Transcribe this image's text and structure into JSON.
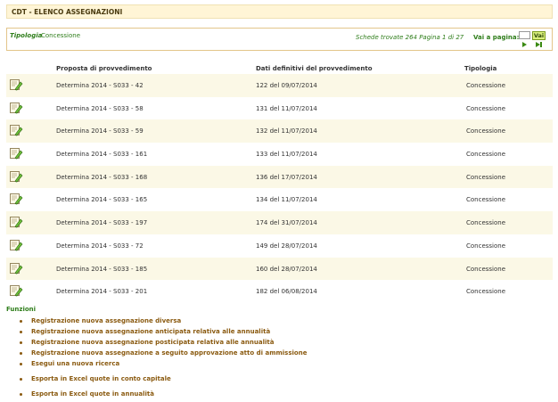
{
  "header": {
    "title": "CDT - ELENCO ASSEGNAZIONI"
  },
  "filter": {
    "tipologia_label": "Tipologia",
    "tipologia_value": "Concessione",
    "schede_text": "Schede trovate 264 Pagina 1 di 27",
    "vai_label": "Vai a pagina:",
    "vai_button": "Vai",
    "page_input_value": ""
  },
  "table": {
    "columns": [
      "Proposta di provvedimento",
      "Dati definitivi del provvedimento",
      "Tipologia"
    ],
    "rows": [
      {
        "proposta": "Determina 2014 - S033 - 42",
        "dati": "122 del 09/07/2014",
        "tipologia": "Concessione"
      },
      {
        "proposta": "Determina 2014 - S033 - 58",
        "dati": "131 del 11/07/2014",
        "tipologia": "Concessione"
      },
      {
        "proposta": "Determina 2014 - S033 - 59",
        "dati": "132 del 11/07/2014",
        "tipologia": "Concessione"
      },
      {
        "proposta": "Determina 2014 - S033 - 161",
        "dati": "133 del 11/07/2014",
        "tipologia": "Concessione"
      },
      {
        "proposta": "Determina 2014 - S033 - 168",
        "dati": "136 del 17/07/2014",
        "tipologia": "Concessione"
      },
      {
        "proposta": "Determina 2014 - S033 - 165",
        "dati": "134 del 11/07/2014",
        "tipologia": "Concessione"
      },
      {
        "proposta": "Determina 2014 - S033 - 197",
        "dati": "174 del 31/07/2014",
        "tipologia": "Concessione"
      },
      {
        "proposta": "Determina 2014 - S033 - 72",
        "dati": "149 del 28/07/2014",
        "tipologia": "Concessione"
      },
      {
        "proposta": "Determina 2014 - S033 - 185",
        "dati": "160 del 28/07/2014",
        "tipologia": "Concessione"
      },
      {
        "proposta": "Determina 2014 - S033 - 201",
        "dati": "182 del 06/08/2014",
        "tipologia": "Concessione"
      }
    ]
  },
  "funzioni": {
    "title": "Funzioni",
    "items": [
      "Registrazione nuova assegnazione diversa",
      "Registrazione nuova assegnazione anticipata relativa alle annualità",
      "Registrazione nuova assegnazione posticipata relativa alle annualità",
      "Registrazione nuova assegnazione a seguito approvazione atto di ammissione",
      "Esegui una nuova ricerca",
      "Esporta in Excel quote in conto capitale",
      "Esporta in Excel quote in annualità"
    ]
  },
  "icons": {
    "row_icon": "edit-document-icon",
    "next": "next-page-icon",
    "last": "last-page-icon"
  },
  "colors": {
    "accent_green": "#2e7d1a",
    "link_brown": "#8a5a10",
    "title_bg": "#fff5d6",
    "row_shade": "#fbf8e6"
  }
}
